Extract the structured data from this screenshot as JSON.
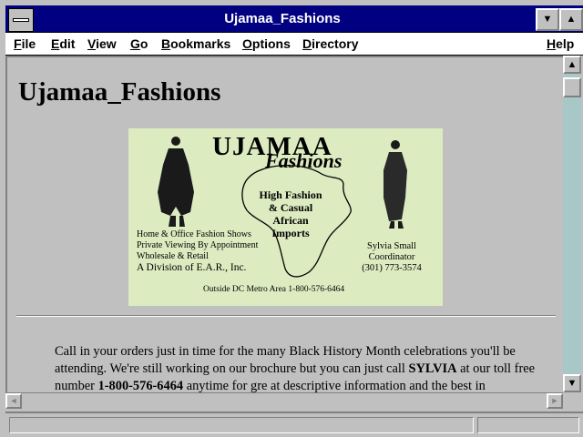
{
  "window": {
    "title": "Ujamaa_Fashions",
    "minimize_glyph": "▼",
    "maximize_glyph": "▲"
  },
  "menu": {
    "items": [
      {
        "key": "F",
        "rest": "ile"
      },
      {
        "key": "E",
        "rest": "dit"
      },
      {
        "key": "V",
        "rest": "iew"
      },
      {
        "key": "G",
        "rest": "o"
      },
      {
        "key": "B",
        "rest": "ookmarks"
      },
      {
        "key": "O",
        "rest": "ptions"
      },
      {
        "key": "D",
        "rest": "irectory"
      }
    ],
    "help": {
      "key": "H",
      "rest": "elp"
    }
  },
  "page": {
    "heading": "Ujamaa_Fashions",
    "card": {
      "logo_main": "UJAMAA",
      "logo_sub": "Fashions",
      "map_text": [
        "High Fashion",
        "& Casual",
        "African",
        "Imports"
      ],
      "services": [
        "Home & Office Fashion Shows",
        "Private Viewing By Appointment",
        "Wholesale & Retail"
      ],
      "division": "A Division of E.A.R., Inc.",
      "contact_name": "Sylvia Small",
      "contact_title": "Coordinator",
      "contact_phone": "(301) 773-3574",
      "toll_free": "Outside DC Metro Area 1-800-576-6464"
    },
    "paragraph": {
      "part1": "Call in your orders just in time for the many Black History Month celebrations you'll be attending. We're still working on our brochure but you can just call ",
      "bold_name": "SYLVIA",
      "part2": " at our toll free number ",
      "bold_phone": "1-800-576-6464",
      "part3": " anytime for gre at descriptive information and the best in"
    }
  },
  "scrollbars": {
    "up_glyph": "▲",
    "down_glyph": "▼",
    "left_glyph": "◄",
    "right_glyph": "►"
  },
  "status": {
    "text": ""
  },
  "colors": {
    "titlebar": "#000080",
    "window_bg": "#c0c0c0",
    "scroll_track": "#a8c8c8",
    "card_bg": "#dcebc0"
  }
}
